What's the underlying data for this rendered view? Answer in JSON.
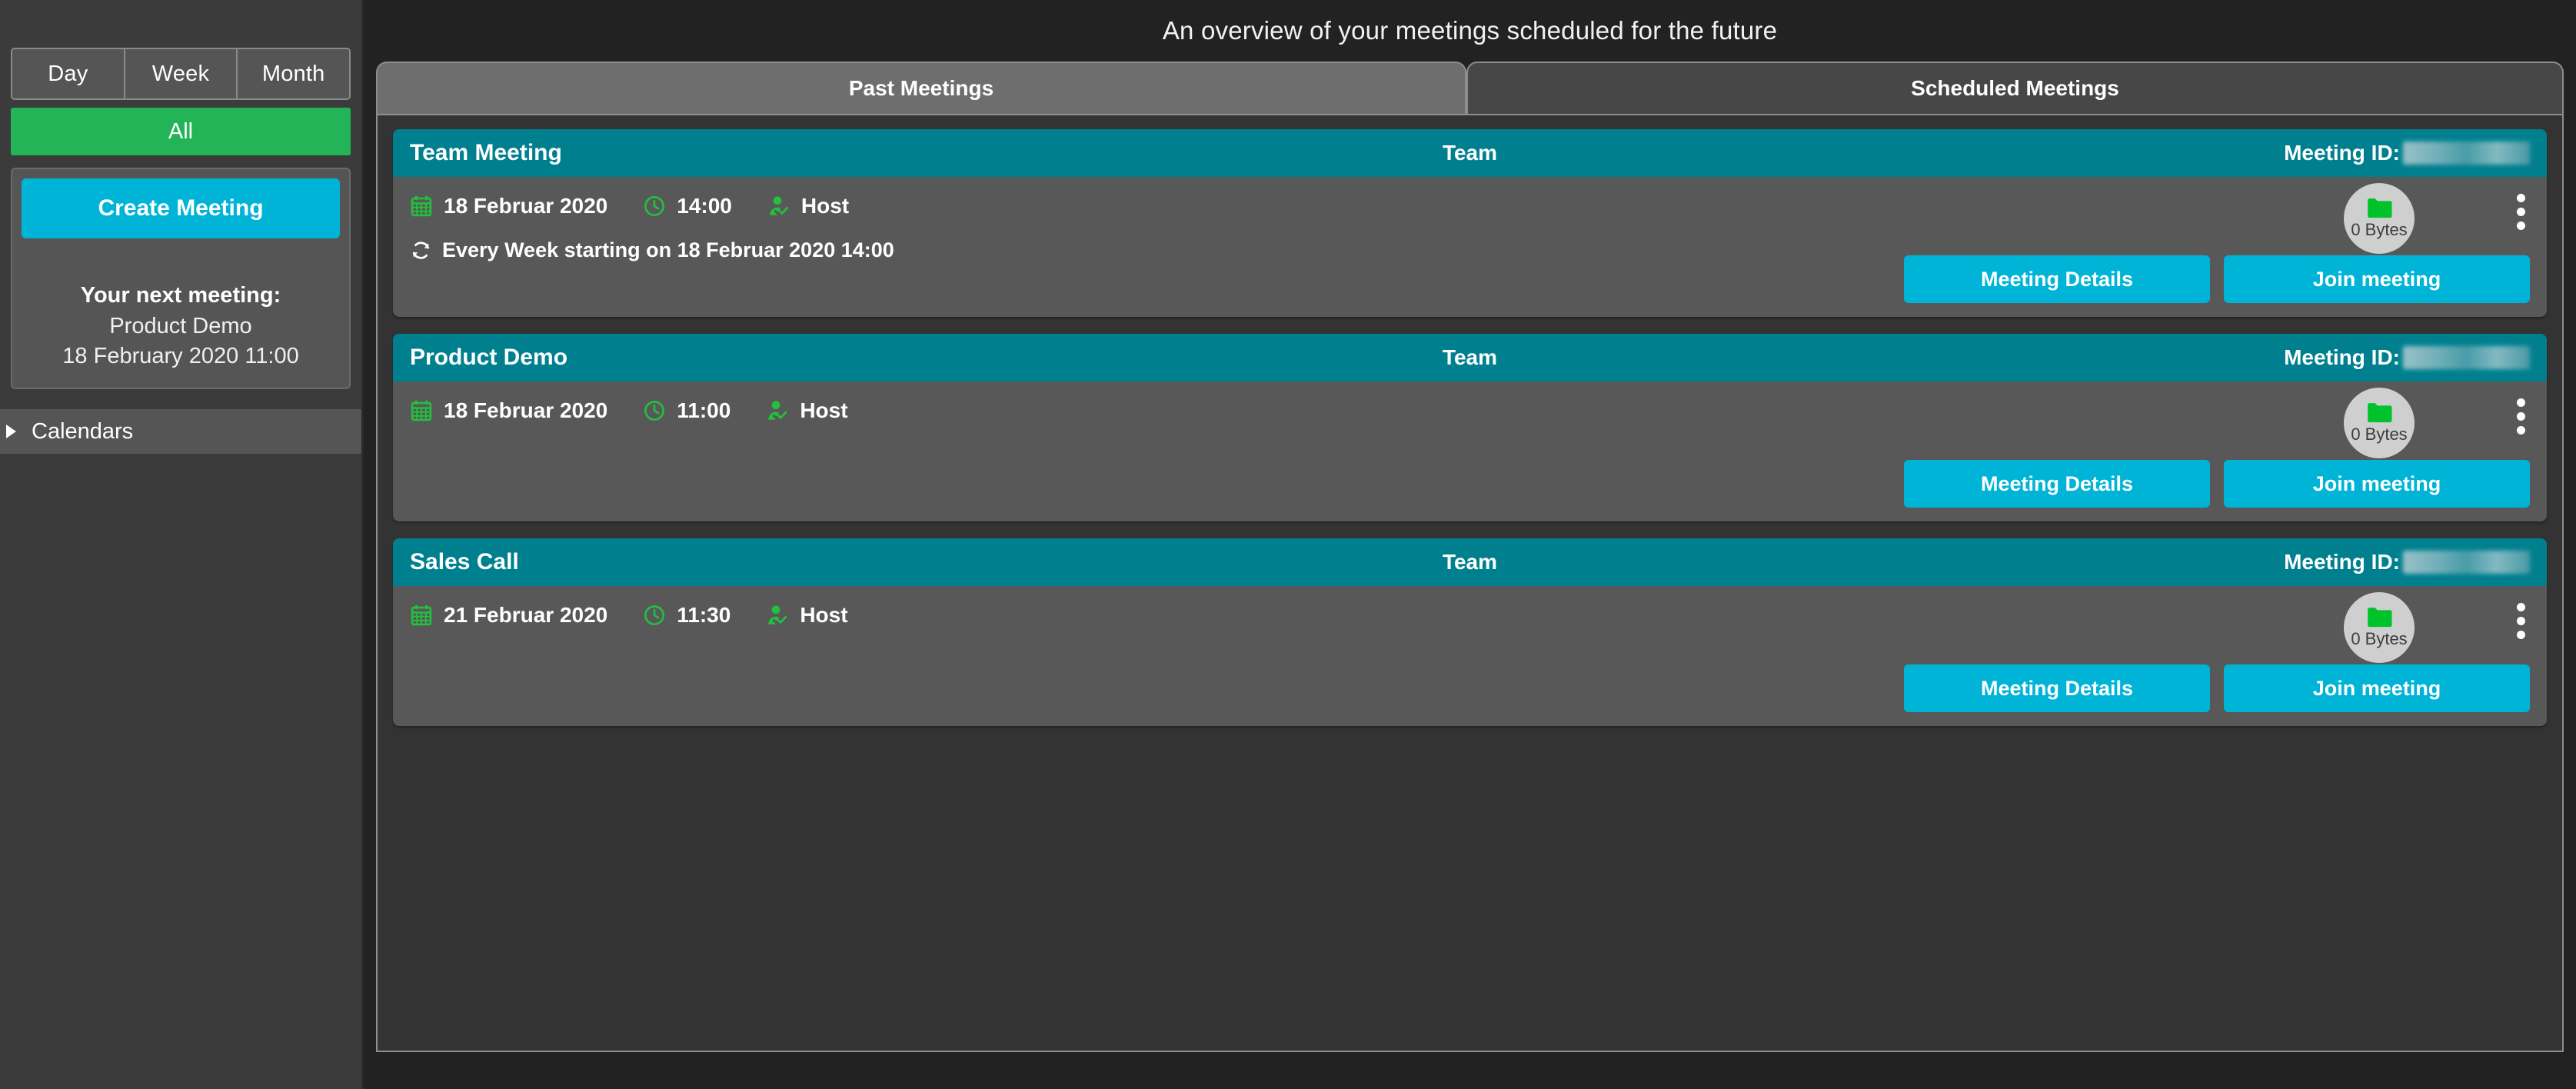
{
  "colors": {
    "accent_cyan": "#00b4d8",
    "accent_green": "#22b457",
    "card_header_teal": "#00808f",
    "sidebar_bg": "#3b3b3b",
    "card_bg": "#585858",
    "panel_bg": "#333333",
    "page_bg": "#222222"
  },
  "sidebar": {
    "view_modes": [
      {
        "label": "Day",
        "icon": "day-icon"
      },
      {
        "label": "Week",
        "icon": "week-icon"
      },
      {
        "label": "Month",
        "icon": "month-icon"
      }
    ],
    "all_filter_label": "All",
    "create_meeting_label": "Create Meeting",
    "next_meeting": {
      "title": "Your next meeting:",
      "name": "Product Demo",
      "datetime": "18 February 2020 11:00"
    },
    "calendars": {
      "label": "Calendars",
      "caret_icon": "caret-right-icon",
      "expanded": false
    }
  },
  "header": {
    "subtitle": "An overview of your meetings scheduled for the future"
  },
  "tabs": [
    {
      "label": "Past Meetings",
      "active": true
    },
    {
      "label": "Scheduled Meetings",
      "active": false
    }
  ],
  "meeting_list": {
    "meeting_id_label": "Meeting ID:",
    "meeting_id_value": "",
    "meeting_id_redacted": true,
    "team_label": "Team",
    "details_label": "Meeting Details",
    "join_label": "Join meeting",
    "size_label": "0 Bytes",
    "folder_icon": "folder-icon",
    "calendar_icon": "calendar-icon",
    "clock_icon": "clock-icon",
    "host_icon": "user-check-icon",
    "recurrence_icon": "repeat-icon",
    "kebab_icon": "kebab-menu-icon",
    "items": [
      {
        "title": "Team Meeting",
        "date": "18 Februar 2020",
        "time": "14:00",
        "role": "Host",
        "recurrence": "Every Week starting on 18 Februar 2020 14:00",
        "has_recurrence": true
      },
      {
        "title": "Product Demo",
        "date": "18 Februar 2020",
        "time": "11:00",
        "role": "Host",
        "recurrence": "",
        "has_recurrence": false
      },
      {
        "title": "Sales Call",
        "date": "21 Februar 2020",
        "time": "11:30",
        "role": "Host",
        "recurrence": "",
        "has_recurrence": false
      }
    ]
  }
}
